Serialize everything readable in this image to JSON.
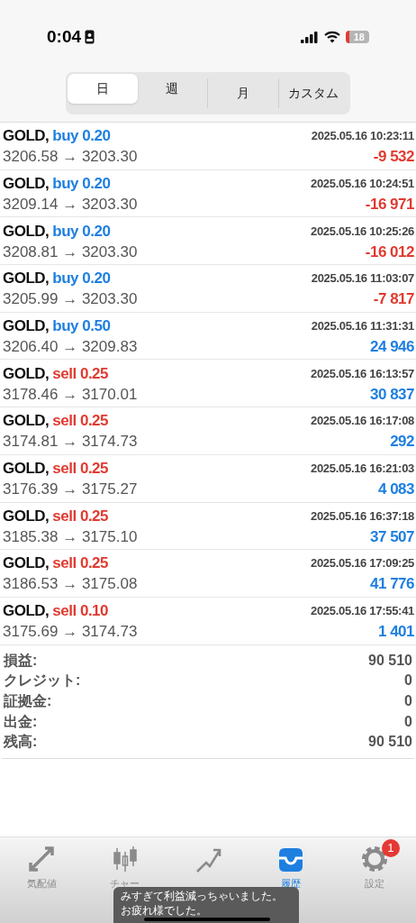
{
  "status_bar": {
    "time": "0:04",
    "battery": "18"
  },
  "period_tabs": [
    {
      "label": "日",
      "selected": true
    },
    {
      "label": "週",
      "selected": false
    },
    {
      "label": "月",
      "selected": false
    },
    {
      "label": "カスタム",
      "selected": false
    }
  ],
  "trades": [
    {
      "symbol": "GOLD,",
      "kind": "buy",
      "volume": "buy 0.20",
      "time": "2025.05.16 10:23:11",
      "prices": "3206.58 → 3203.30",
      "profit": "-9 532",
      "loss": true
    },
    {
      "symbol": "GOLD,",
      "kind": "buy",
      "volume": "buy 0.20",
      "time": "2025.05.16 10:24:51",
      "prices": "3209.14 → 3203.30",
      "profit": "-16 971",
      "loss": true
    },
    {
      "symbol": "GOLD,",
      "kind": "buy",
      "volume": "buy 0.20",
      "time": "2025.05.16 10:25:26",
      "prices": "3208.81 → 3203.30",
      "profit": "-16 012",
      "loss": true
    },
    {
      "symbol": "GOLD,",
      "kind": "buy",
      "volume": "buy 0.20",
      "time": "2025.05.16 11:03:07",
      "prices": "3205.99 → 3203.30",
      "profit": "-7 817",
      "loss": true
    },
    {
      "symbol": "GOLD,",
      "kind": "buy",
      "volume": "buy 0.50",
      "time": "2025.05.16 11:31:31",
      "prices": "3206.40 → 3209.83",
      "profit": "24 946",
      "loss": false
    },
    {
      "symbol": "GOLD,",
      "kind": "sell",
      "volume": "sell 0.25",
      "time": "2025.05.16 16:13:57",
      "prices": "3178.46 → 3170.01",
      "profit": "30 837",
      "loss": false
    },
    {
      "symbol": "GOLD,",
      "kind": "sell",
      "volume": "sell 0.25",
      "time": "2025.05.16 16:17:08",
      "prices": "3174.81 → 3174.73",
      "profit": "292",
      "loss": false
    },
    {
      "symbol": "GOLD,",
      "kind": "sell",
      "volume": "sell 0.25",
      "time": "2025.05.16 16:21:03",
      "prices": "3176.39 → 3175.27",
      "profit": "4 083",
      "loss": false
    },
    {
      "symbol": "GOLD,",
      "kind": "sell",
      "volume": "sell 0.25",
      "time": "2025.05.16 16:37:18",
      "prices": "3185.38 → 3175.10",
      "profit": "37 507",
      "loss": false
    },
    {
      "symbol": "GOLD,",
      "kind": "sell",
      "volume": "sell 0.25",
      "time": "2025.05.16 17:09:25",
      "prices": "3186.53 → 3175.08",
      "profit": "41 776",
      "loss": false
    },
    {
      "symbol": "GOLD,",
      "kind": "sell",
      "volume": "sell 0.10",
      "time": "2025.05.16 17:55:41",
      "prices": "3175.69 → 3174.73",
      "profit": "1 401",
      "loss": false
    }
  ],
  "summary": [
    {
      "label": "損益:",
      "value": "90 510"
    },
    {
      "label": "クレジット:",
      "value": "0"
    },
    {
      "label": "証拠金:",
      "value": "0"
    },
    {
      "label": "出金:",
      "value": "0"
    },
    {
      "label": "残高:",
      "value": "90 510"
    }
  ],
  "tab_bar": [
    {
      "kind": "quotes",
      "label": "気配値",
      "selected": false
    },
    {
      "kind": "chart",
      "label": "チャー",
      "selected": false
    },
    {
      "kind": "trade",
      "selected": false
    },
    {
      "kind": "history",
      "label": "履歴",
      "selected": true
    },
    {
      "kind": "settings",
      "label": "設定",
      "selected": false,
      "badge": "1"
    }
  ],
  "caption": {
    "lines": [
      "みすぎて利益減っちゃいました。",
      "お疲れ様でした。"
    ]
  }
}
